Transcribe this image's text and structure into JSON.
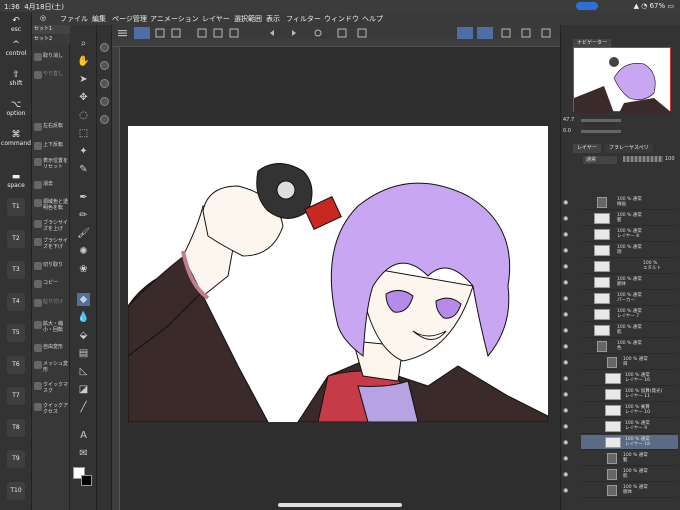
{
  "status": {
    "time": "1:36",
    "date": "4月18日(土)",
    "battery": "67%"
  },
  "menu": [
    "ファイル",
    "編集",
    "ページ管理",
    "アニメーション",
    "レイヤー",
    "選択範囲",
    "表示",
    "フィルター",
    "ウィンドウ",
    "ヘルプ"
  ],
  "shortcuts": {
    "esc": "esc",
    "control": "control",
    "shift": "shift",
    "option": "option",
    "command": "command",
    "space": "space",
    "keys": [
      "T1",
      "T2",
      "T3",
      "T4",
      "T5",
      "T6",
      "T7",
      "T8",
      "T9",
      "T10"
    ]
  },
  "subtool": {
    "set1": "セット1",
    "set2": "セット2",
    "items": [
      "取り消し",
      "やり直し",
      "左右反転",
      "上下反転",
      "表示位置をリセット",
      "消去",
      "領域色と透明色を転",
      "ブラシサイズを上げ",
      "ブラシサイズを下げ",
      "切り取り",
      "コピー",
      "貼り付け",
      "拡大・縮小・回転",
      "自由変形",
      "メッシュ変形",
      "クイックマスク",
      "クイックアクセス"
    ]
  },
  "navigator": {
    "title": "ナビゲーター",
    "zoom": "47.7",
    "angle": "0.0"
  },
  "layers": {
    "tab1": "レイヤー",
    "tab2": "フラレーヤスペリ",
    "blend": "通常",
    "opacity": "100",
    "rows": [
      {
        "opacity": "100 %",
        "blend": "通常",
        "name": "線画"
      },
      {
        "opacity": "100 %",
        "blend": "通常",
        "name": "髪"
      },
      {
        "opacity": "100 %",
        "blend": "通常",
        "name": "レイヤー 8"
      },
      {
        "opacity": "100 %",
        "blend": "通常",
        "name": "顔"
      },
      {
        "opacity": "100 %",
        "blend": "",
        "name": "エタルト"
      },
      {
        "opacity": "100 %",
        "blend": "通常",
        "name": "胴体"
      },
      {
        "opacity": "100 %",
        "blend": "通常",
        "name": "パーカー"
      },
      {
        "opacity": "100 %",
        "blend": "通常",
        "name": "レイヤー 7"
      },
      {
        "opacity": "100 %",
        "blend": "通常",
        "name": "肌"
      },
      {
        "opacity": "100 %",
        "blend": "通常",
        "name": "色"
      },
      {
        "opacity": "100 %",
        "blend": "通常",
        "name": "目"
      },
      {
        "opacity": "100 %",
        "blend": "通常",
        "name": "レイヤー 16"
      },
      {
        "opacity": "100 %",
        "blend": "加算(発光)",
        "name": "レイヤー 11"
      },
      {
        "opacity": "100 %",
        "blend": "乗算",
        "name": "レイヤー 10"
      },
      {
        "opacity": "100 %",
        "blend": "通常",
        "name": "レイヤー 9"
      },
      {
        "opacity": "100 %",
        "blend": "通常",
        "name": "レイヤー 18"
      },
      {
        "opacity": "100 %",
        "blend": "通常",
        "name": "髪"
      },
      {
        "opacity": "100 %",
        "blend": "通常",
        "name": "肌"
      },
      {
        "opacity": "100 %",
        "blend": "通常",
        "name": "胴体"
      }
    ]
  }
}
